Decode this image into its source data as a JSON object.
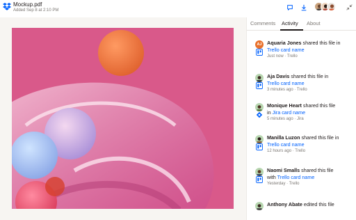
{
  "header": {
    "file_name": "Mockup.pdf",
    "subtitle": "Added Sep 8 at 2:10 PM",
    "icons": [
      "dropbox-logo",
      "comment-icon",
      "download-icon",
      "avatar-stack",
      "collapse-icon"
    ]
  },
  "tabs": [
    {
      "label": "Comments",
      "active": false
    },
    {
      "label": "Activity",
      "active": true
    },
    {
      "label": "About",
      "active": false
    }
  ],
  "activity": [
    {
      "initials": "AJ",
      "name": "Aquaria Jones",
      "action": "shared this file in",
      "link_prefix": "",
      "link": "Trello card name",
      "link_icon": "trello-icon",
      "meta": "Just now · Trello"
    },
    {
      "initials": "",
      "name": "Aja Davis",
      "action": "shared this file in",
      "link_prefix": "",
      "link": "Trello card name",
      "link_icon": "trello-icon",
      "meta": "3 minutes ago · Trello"
    },
    {
      "initials": "",
      "name": "Monique Heart",
      "action": "shared this file",
      "link_prefix": "in",
      "link": "Jira card name",
      "link_icon": "jira-icon",
      "meta": "5 minutes ago · Jira"
    },
    {
      "initials": "",
      "name": "Manilla Luzon",
      "action": "shared this file in",
      "link_prefix": "",
      "link": "Trello card name",
      "link_icon": "trello-icon",
      "meta": "12 hours ago · Trello"
    },
    {
      "initials": "",
      "name": "Naomi Smalls",
      "action": "shared this file",
      "link_prefix": "with",
      "link": "Trello card name",
      "link_icon": "trello-icon",
      "meta": "Yesterday · Trello"
    },
    {
      "initials": "",
      "name": "Anthony Abate",
      "action": "edited this file",
      "link_prefix": "",
      "link": "",
      "link_icon": "",
      "meta": ""
    }
  ],
  "colors": {
    "accent": "#0061fe",
    "art_background": "#d9598a",
    "aj_avatar": "#e8702a"
  }
}
